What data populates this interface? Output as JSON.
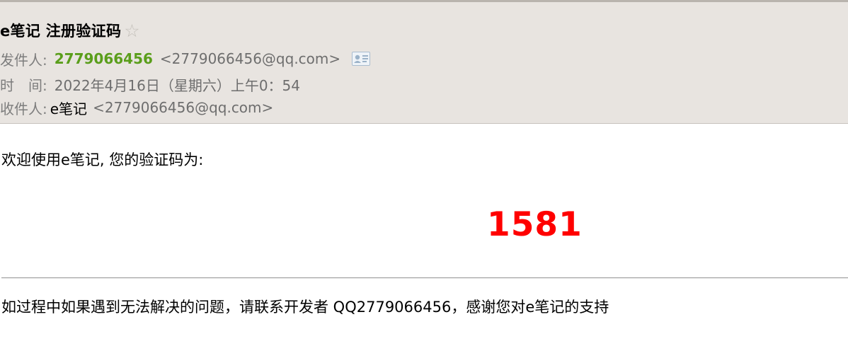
{
  "email": {
    "subject": "e笔记 注册验证码",
    "sender_label": "发件人:",
    "sender_name": "2779066456",
    "sender_email": "<2779066456@qq.com>",
    "time_label": "时　间:",
    "time_value": "2022年4月16日（星期六）上午0：54",
    "recipient_label": "收件人:",
    "recipient_name": "e笔记",
    "recipient_email": "<2779066456@qq.com>"
  },
  "body": {
    "greeting": "欢迎使用e笔记, 您的验证码为:",
    "code": "1581",
    "footer": "如过程中如果遇到无法解决的问题，请联系开发者 QQ2779066456，感谢您对e笔记的支持"
  },
  "colors": {
    "header_bg": "#e8e4e0",
    "sender_green": "#5a9e1b",
    "code_red": "#ff0000"
  },
  "icons": {
    "star": "star-icon",
    "contact_card": "contact-card-icon"
  }
}
